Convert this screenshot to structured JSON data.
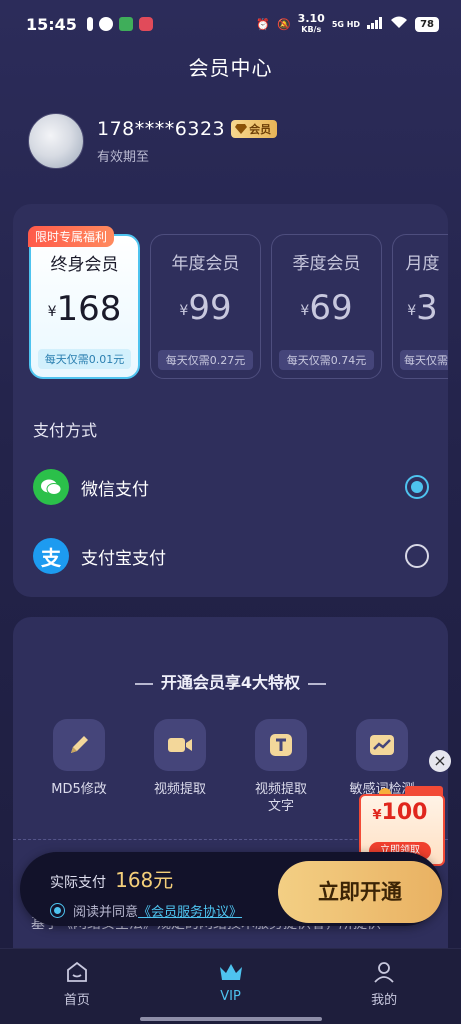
{
  "status_bar": {
    "time": "15:45",
    "network_speed": "3.10",
    "network_unit": "KB/s",
    "network_type": "5G HD",
    "battery": "78"
  },
  "page": {
    "title": "会员中心"
  },
  "user": {
    "phone": "178****6323",
    "badge": "会员",
    "valid_label": "有效期至"
  },
  "plans": [
    {
      "name": "终身会员",
      "currency": "¥",
      "price": "168",
      "daily": "每天仅需0.01元",
      "tag": "限时专属福利",
      "selected": true
    },
    {
      "name": "年度会员",
      "currency": "¥",
      "price": "99",
      "daily": "每天仅需0.27元",
      "selected": false
    },
    {
      "name": "季度会员",
      "currency": "¥",
      "price": "69",
      "daily": "每天仅需0.74元",
      "selected": false
    },
    {
      "name": "月度",
      "currency": "¥",
      "price": "3",
      "daily": "每天仅需",
      "selected": false
    }
  ],
  "payment": {
    "title": "支付方式",
    "methods": [
      {
        "label": "微信支付",
        "icon": "wechat-pay-icon",
        "checked": true
      },
      {
        "label": "支付宝支付",
        "icon": "alipay-icon",
        "checked": false
      }
    ]
  },
  "perks": {
    "title": "开通会员享4大特权",
    "items": [
      {
        "label": "MD5修改",
        "icon": "pencil-icon"
      },
      {
        "label": "视频提取",
        "icon": "video-camera-icon"
      },
      {
        "label": "视频提取文字",
        "icon": "text-t-icon"
      },
      {
        "label": "敏感词检测",
        "icon": "chart-icon"
      }
    ],
    "law_text": "基于《网络安全法》规定的网络技术服务提供者，所提供"
  },
  "coupon": {
    "currency": "¥",
    "amount": "100",
    "button": "立即领取"
  },
  "pay_bar": {
    "actual_label": "实际支付",
    "actual_amount": "168元",
    "agree_prefix": "阅读并同意",
    "agreement": "《会员服务协议》",
    "button": "立即开通"
  },
  "tabbar": [
    {
      "label": "首页",
      "icon": "home-icon",
      "active": false
    },
    {
      "label": "VIP",
      "icon": "crown-icon",
      "active": true
    },
    {
      "label": "我的",
      "icon": "profile-icon",
      "active": false
    }
  ],
  "colors": {
    "accent": "#4ec3ef",
    "gold": "#f4cf7a",
    "background": "#2c2c5a",
    "card": "#2f2f5c"
  }
}
